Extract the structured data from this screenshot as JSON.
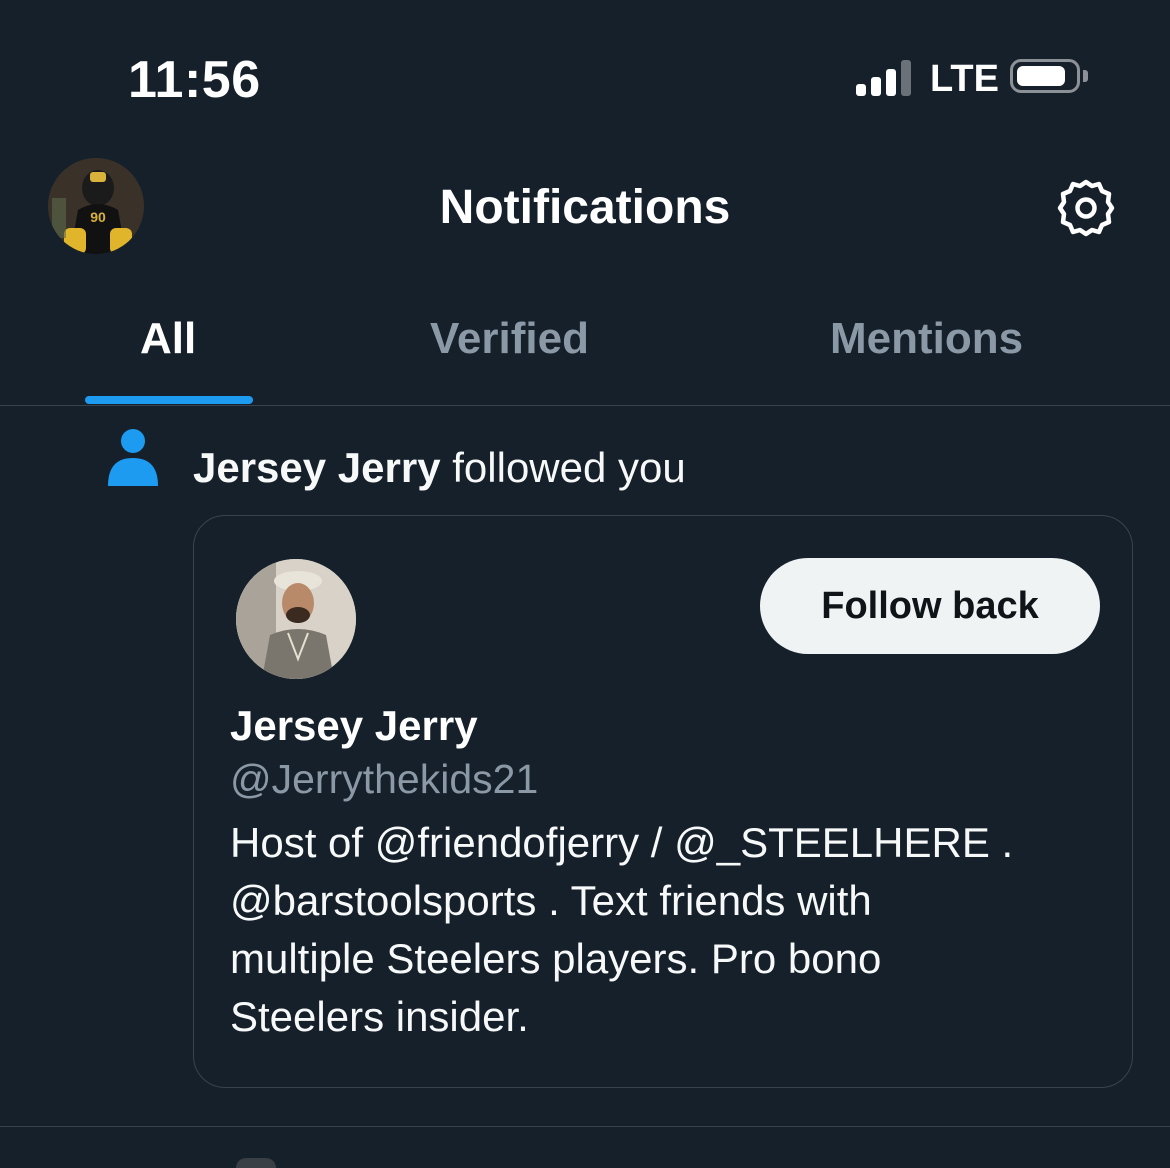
{
  "status_bar": {
    "time": "11:56",
    "network": "LTE",
    "signal_bars": 3,
    "signal_bars_total": 4,
    "battery_level": 0.85
  },
  "header": {
    "title": "Notifications",
    "avatar_icon": "profile-avatar",
    "settings_icon": "gear-icon"
  },
  "tabs": [
    {
      "label": "All",
      "active": true
    },
    {
      "label": "Verified",
      "active": false
    },
    {
      "label": "Mentions",
      "active": false
    }
  ],
  "notification": {
    "icon": "person-icon",
    "name": "Jersey Jerry",
    "action": "followed you",
    "card": {
      "name": "Jersey Jerry",
      "handle": "@Jerrythekids21",
      "follow_label": "Follow back",
      "bio_lines": [
        "Host of @friendofjerry / @_STEELHERE .",
        "@barstoolsports . Text friends with",
        "multiple Steelers players. Pro bono",
        "Steelers insider."
      ]
    }
  },
  "colors": {
    "background": "#15202b",
    "accent": "#1d9bf0",
    "muted_text": "#8b98a5",
    "divider": "#38444d"
  }
}
